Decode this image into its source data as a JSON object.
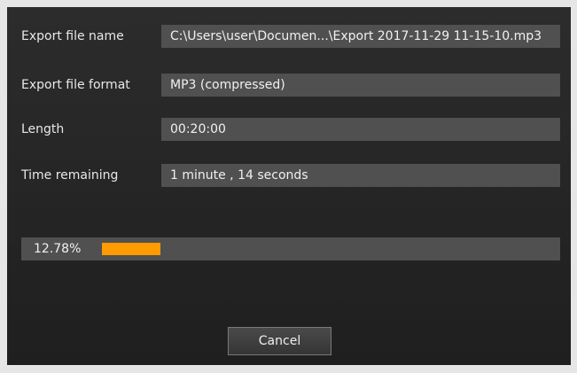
{
  "fields": [
    {
      "label": "Export file name",
      "value": "C:\\Users\\user\\Documen...\\Export 2017-11-29 11-15-10.mp3"
    },
    {
      "label": "Export file format",
      "value": "MP3 (compressed)"
    },
    {
      "label": "Length",
      "value": "00:20:00"
    },
    {
      "label": "Time remaining",
      "value": "1 minute , 14 seconds"
    }
  ],
  "progress": {
    "percent_text": "12.78%",
    "fraction": 0.1278,
    "color": "#ff9a00"
  },
  "actions": {
    "cancel_label": "Cancel"
  }
}
